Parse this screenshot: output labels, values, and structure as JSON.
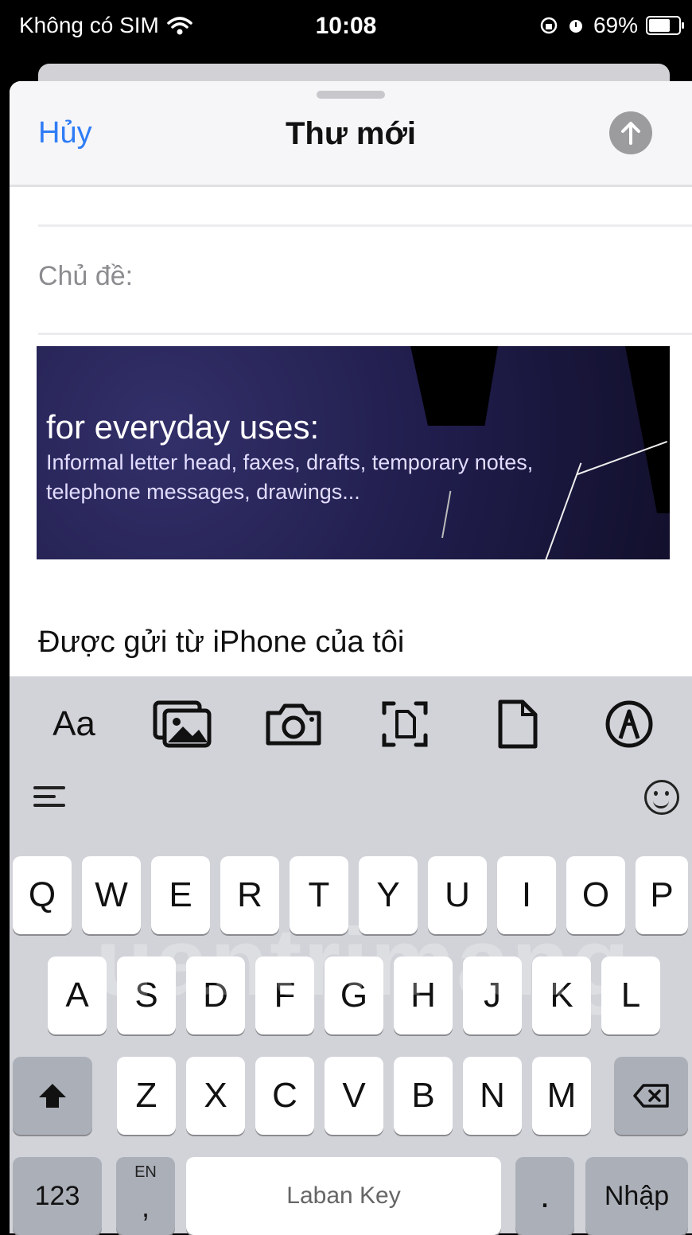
{
  "status": {
    "carrier": "Không có SIM",
    "time": "10:08",
    "battery": "69%"
  },
  "header": {
    "cancel": "Hủy",
    "title": "Thư mới"
  },
  "compose": {
    "subject_label": "Chủ đề:",
    "banner": {
      "heading": "for everyday uses:",
      "line1": "Informal letter head, faxes, drafts, temporary notes,",
      "line2": "telephone messages, drawings..."
    },
    "signature": "Được gửi từ iPhone của tôi"
  },
  "tools": {
    "format": "Aa"
  },
  "keyboard": {
    "row1": [
      "Q",
      "W",
      "E",
      "R",
      "T",
      "Y",
      "U",
      "I",
      "O",
      "P"
    ],
    "row2": [
      "A",
      "S",
      "D",
      "F",
      "G",
      "H",
      "J",
      "K",
      "L"
    ],
    "row3": [
      "Z",
      "X",
      "C",
      "V",
      "B",
      "N",
      "M"
    ],
    "numbers": "123",
    "lang": "EN",
    "comma": ",",
    "space": "Laban Key",
    "period": ".",
    "return": "Nhập"
  },
  "watermark": "uantrimang",
  "colors": {
    "accent": "#2f7cf6",
    "keyboard_bg": "#d1d3d9",
    "send_disabled": "#9c9c9f"
  }
}
